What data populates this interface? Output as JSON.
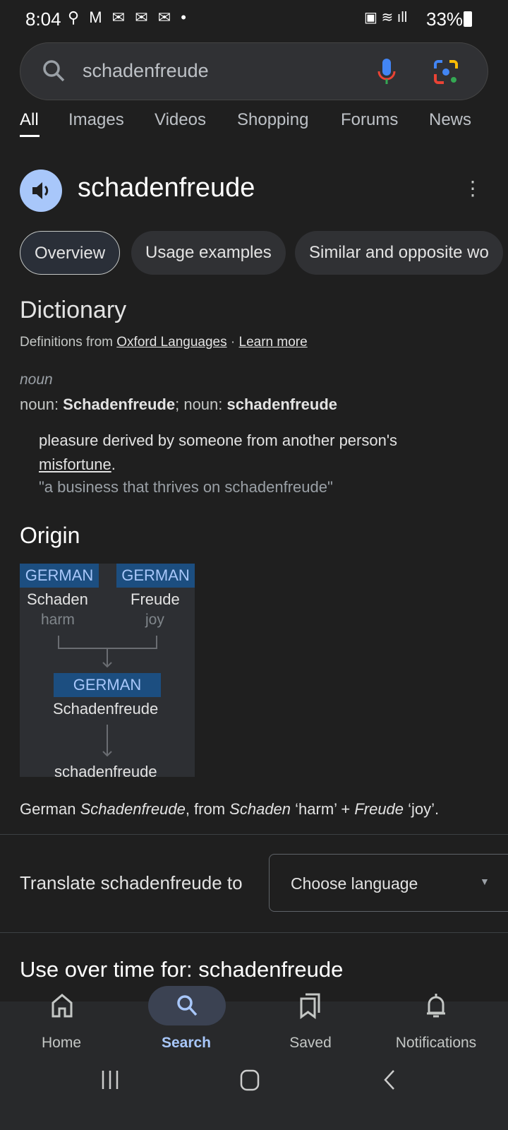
{
  "status": {
    "time": "8:04",
    "battery": "33%"
  },
  "search": {
    "query": "schadenfreude"
  },
  "tabs": [
    "All",
    "Images",
    "Videos",
    "Shopping",
    "Forums",
    "News"
  ],
  "word": {
    "title": "schadenfreude"
  },
  "chips": [
    "Overview",
    "Usage examples",
    "Similar and opposite wo"
  ],
  "dictionary": {
    "heading": "Dictionary",
    "source_prefix": "Definitions from",
    "source_link": "Oxford Languages",
    "sep": " · ",
    "learn_more": "Learn more",
    "pos": "noun",
    "forms_prefix": "noun: ",
    "form1": "Schadenfreude",
    "forms_mid": "; noun: ",
    "form2": "schadenfreude",
    "definition": "pleasure derived by someone from another person's",
    "definition_link": "misfortune",
    "definition_end": ".",
    "example": "\"a business that thrives on schadenfreude\""
  },
  "origin": {
    "heading": "Origin",
    "lang1": "GERMAN",
    "word1": "Schaden",
    "gloss1": "harm",
    "lang2": "GERMAN",
    "word2": "Freude",
    "gloss2": "joy",
    "lang3": "GERMAN",
    "word3": "Schadenfreude",
    "result": "schadenfreude",
    "text_a": "German ",
    "text_b": "Schadenfreude",
    "text_c": ", from ",
    "text_d": "Schaden",
    "text_e": " ‘harm’ + ",
    "text_f": "Freude",
    "text_g": " ‘joy’."
  },
  "translate": {
    "label": "Translate schadenfreude to",
    "select": "Choose language"
  },
  "use_over_time": {
    "heading": "Use over time for: schadenfreude"
  },
  "bottom_nav": [
    "Home",
    "Search",
    "Saved",
    "Notifications"
  ],
  "colors": {
    "accent": "#a8c7fa",
    "background": "#1f1f1f"
  }
}
